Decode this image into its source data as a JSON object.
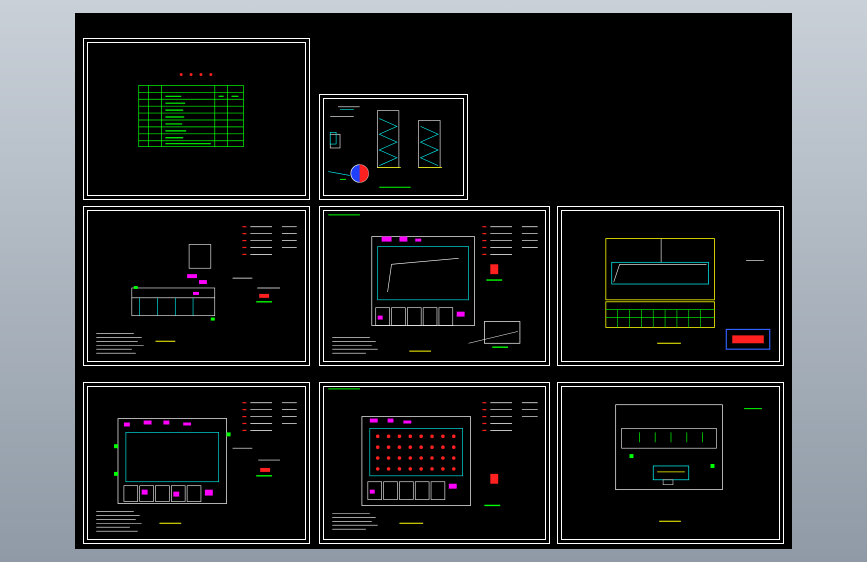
{
  "canvas": {
    "background": "#000000",
    "viewport_bg": "#a9b2bc"
  },
  "sheets": [
    {
      "id": "index",
      "content": "title-and-table"
    },
    {
      "id": "details",
      "content": "stair-section-details"
    },
    {
      "id": "plan-1",
      "content": "l-shaped-floor-plan"
    },
    {
      "id": "plan-2",
      "content": "courtyard-floor-plan"
    },
    {
      "id": "plan-3",
      "content": "roof-plan"
    },
    {
      "id": "plan-4",
      "content": "courtyard-floor-plan-alt"
    },
    {
      "id": "plan-5",
      "content": "hall-floor-plan-grid"
    },
    {
      "id": "plan-6",
      "content": "elevation-outline"
    }
  ],
  "colors": {
    "line_white": "#ffffff",
    "line_green": "#00ff00",
    "line_cyan": "#00ffff",
    "line_yellow": "#ffff00",
    "line_magenta": "#ff00ff",
    "line_red": "#ff2020",
    "line_blue": "#3060ff"
  }
}
